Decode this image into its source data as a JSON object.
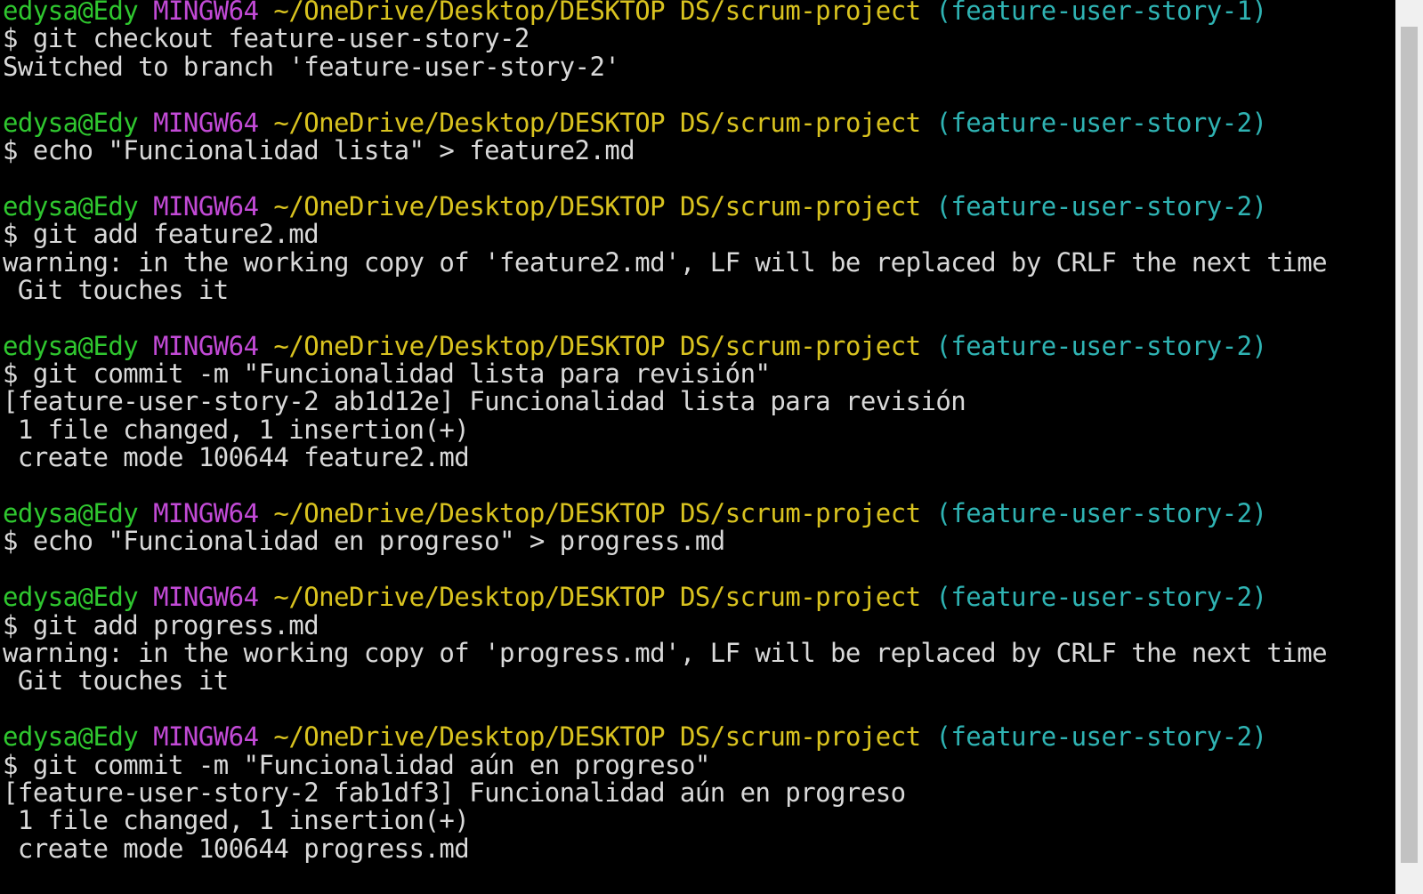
{
  "terminal": {
    "lines": [
      {
        "kind": "prompt",
        "user": "edysa@Edy",
        "system": "MINGW64",
        "path": "~/OneDrive/Desktop/DESKTOP DS/scrum-project",
        "branch": "(feature-user-story-1)"
      },
      {
        "kind": "text",
        "text": "$ git checkout feature-user-story-2"
      },
      {
        "kind": "text",
        "text": "Switched to branch 'feature-user-story-2'"
      },
      {
        "kind": "text",
        "text": ""
      },
      {
        "kind": "prompt",
        "user": "edysa@Edy",
        "system": "MINGW64",
        "path": "~/OneDrive/Desktop/DESKTOP DS/scrum-project",
        "branch": "(feature-user-story-2)"
      },
      {
        "kind": "text",
        "text": "$ echo \"Funcionalidad lista\" > feature2.md"
      },
      {
        "kind": "text",
        "text": ""
      },
      {
        "kind": "prompt",
        "user": "edysa@Edy",
        "system": "MINGW64",
        "path": "~/OneDrive/Desktop/DESKTOP DS/scrum-project",
        "branch": "(feature-user-story-2)"
      },
      {
        "kind": "text",
        "text": "$ git add feature2.md"
      },
      {
        "kind": "text",
        "text": "warning: in the working copy of 'feature2.md', LF will be replaced by CRLF the next time"
      },
      {
        "kind": "text",
        "text": " Git touches it"
      },
      {
        "kind": "text",
        "text": ""
      },
      {
        "kind": "prompt",
        "user": "edysa@Edy",
        "system": "MINGW64",
        "path": "~/OneDrive/Desktop/DESKTOP DS/scrum-project",
        "branch": "(feature-user-story-2)"
      },
      {
        "kind": "text",
        "text": "$ git commit -m \"Funcionalidad lista para revisión\""
      },
      {
        "kind": "text",
        "text": "[feature-user-story-2 ab1d12e] Funcionalidad lista para revisión"
      },
      {
        "kind": "text",
        "text": " 1 file changed, 1 insertion(+)"
      },
      {
        "kind": "text",
        "text": " create mode 100644 feature2.md"
      },
      {
        "kind": "text",
        "text": ""
      },
      {
        "kind": "prompt",
        "user": "edysa@Edy",
        "system": "MINGW64",
        "path": "~/OneDrive/Desktop/DESKTOP DS/scrum-project",
        "branch": "(feature-user-story-2)"
      },
      {
        "kind": "text",
        "text": "$ echo \"Funcionalidad en progreso\" > progress.md"
      },
      {
        "kind": "text",
        "text": ""
      },
      {
        "kind": "prompt",
        "user": "edysa@Edy",
        "system": "MINGW64",
        "path": "~/OneDrive/Desktop/DESKTOP DS/scrum-project",
        "branch": "(feature-user-story-2)"
      },
      {
        "kind": "text",
        "text": "$ git add progress.md"
      },
      {
        "kind": "text",
        "text": "warning: in the working copy of 'progress.md', LF will be replaced by CRLF the next time"
      },
      {
        "kind": "text",
        "text": " Git touches it"
      },
      {
        "kind": "text",
        "text": ""
      },
      {
        "kind": "prompt",
        "user": "edysa@Edy",
        "system": "MINGW64",
        "path": "~/OneDrive/Desktop/DESKTOP DS/scrum-project",
        "branch": "(feature-user-story-2)"
      },
      {
        "kind": "text",
        "text": "$ git commit -m \"Funcionalidad aún en progreso\""
      },
      {
        "kind": "text",
        "text": "[feature-user-story-2 fab1df3] Funcionalidad aún en progreso"
      },
      {
        "kind": "text",
        "text": " 1 file changed, 1 insertion(+)"
      },
      {
        "kind": "text",
        "text": " create mode 100644 progress.md"
      }
    ]
  },
  "colors": {
    "background": "#000000",
    "text": "#d9d9d9",
    "user": "#2fc72f",
    "system": "#c24ad6",
    "path": "#d9c31f",
    "branch": "#2fb3b3",
    "scrollbar_track": "#f0f0f0",
    "scrollbar_thumb": "#c2c2c2"
  }
}
